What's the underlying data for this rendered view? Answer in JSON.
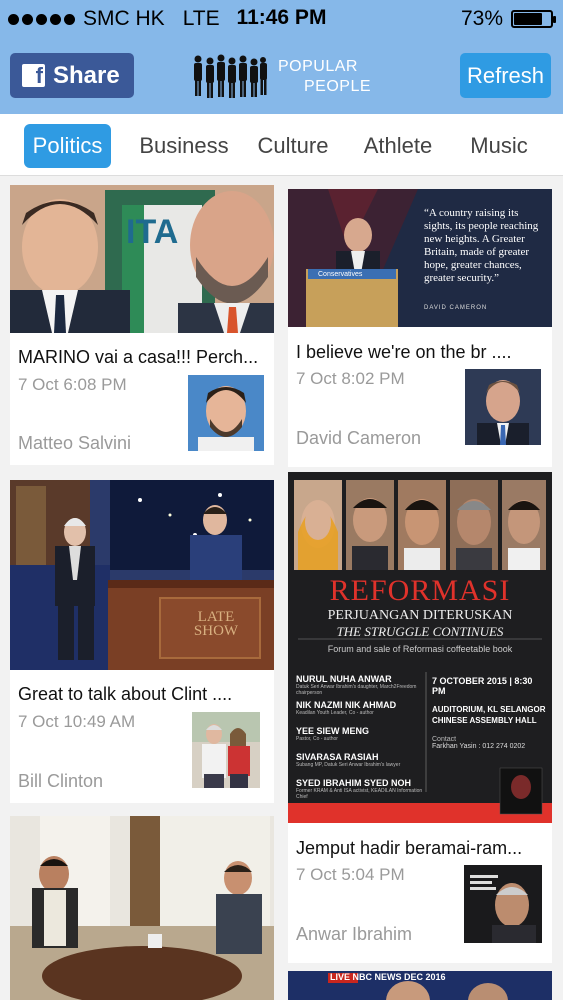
{
  "status_bar": {
    "carrier": "SMC HK",
    "network": "LTE",
    "time": "11:46 PM",
    "battery": "73%",
    "battery_level": 0.73
  },
  "header": {
    "share_label": "Share",
    "logo_line1": "POPULAR",
    "logo_line2": "PEOPLE",
    "refresh_label": "Refresh"
  },
  "tabs": [
    {
      "label": "Politics",
      "active": true
    },
    {
      "label": "Business",
      "active": false
    },
    {
      "label": "Culture",
      "active": false
    },
    {
      "label": "Athlete",
      "active": false
    },
    {
      "label": "Music",
      "active": false
    }
  ],
  "posts": [
    {
      "title": "MARINO vai a casa!!! Perch...",
      "time": "7 Oct 6:08 PM",
      "author": "Matteo Salvini"
    },
    {
      "title": "I believe we're on the br ....",
      "time": "7 Oct 8:02 PM",
      "author": "David Cameron",
      "image_text": "“A country raising its sights, its people reaching new heights. A Greater Britain, made of greater hope, greater chances, greater security.”",
      "image_caption": "DAVID CAMERON",
      "podium_text": "Conservatives"
    },
    {
      "title": "Great to talk about Clint ....",
      "time": "7 Oct 10:49 AM",
      "author": "Bill Clinton",
      "image_text": "LATE SHOW"
    },
    {
      "title": "Jemput hadir beramai-ram...",
      "time": "7 Oct 5:04 PM",
      "author": "Anwar Ibrahim",
      "poster": {
        "heading": "REFORMASI",
        "subheading": "PERJUANGAN DITERUSKAN",
        "subheading_en": "THE STRUGGLE CONTINUES",
        "tagline": "Forum and sale of Reformasi coffeetable book",
        "speakers": [
          {
            "name": "NURUL NUHA ANWAR",
            "desc": "Datuk Seri Anwar Ibrahim's daughter, March2Freedom chairperson"
          },
          {
            "name": "NIK NAZMI NIK AHMAD",
            "desc": "Keadilan Youth Leader, Co - author"
          },
          {
            "name": "YEE SIEW MENG",
            "desc": "Pastor, Co - author"
          },
          {
            "name": "SIVARASA RASIAH",
            "desc": "Subang MP, Datuk Seri Anwar Ibrahim's lawyer"
          },
          {
            "name": "SYED IBRAHIM SYED NOH",
            "desc": "Former KRAM & Anti ISA activist, KEADILAN Information Chief"
          }
        ],
        "date": "7 OCTOBER 2015 | 8:30 PM",
        "venue": "AUDITORIUM, KL SELANGOR CHINESE ASSEMBLY HALL",
        "contact_label": "Contact",
        "contact": "Farkhan Yasin : 012 274 0202"
      }
    },
    {
      "title": "",
      "time": "",
      "author": ""
    },
    {
      "title": "",
      "time": "",
      "author": "",
      "image_text": "LIVE NBC NEWS  DEC  2016"
    }
  ],
  "colors": {
    "header_bg": "#86b8e9",
    "accent": "#2f9be3",
    "facebook": "#3b5998",
    "reformasi_red": "#e0322b"
  }
}
